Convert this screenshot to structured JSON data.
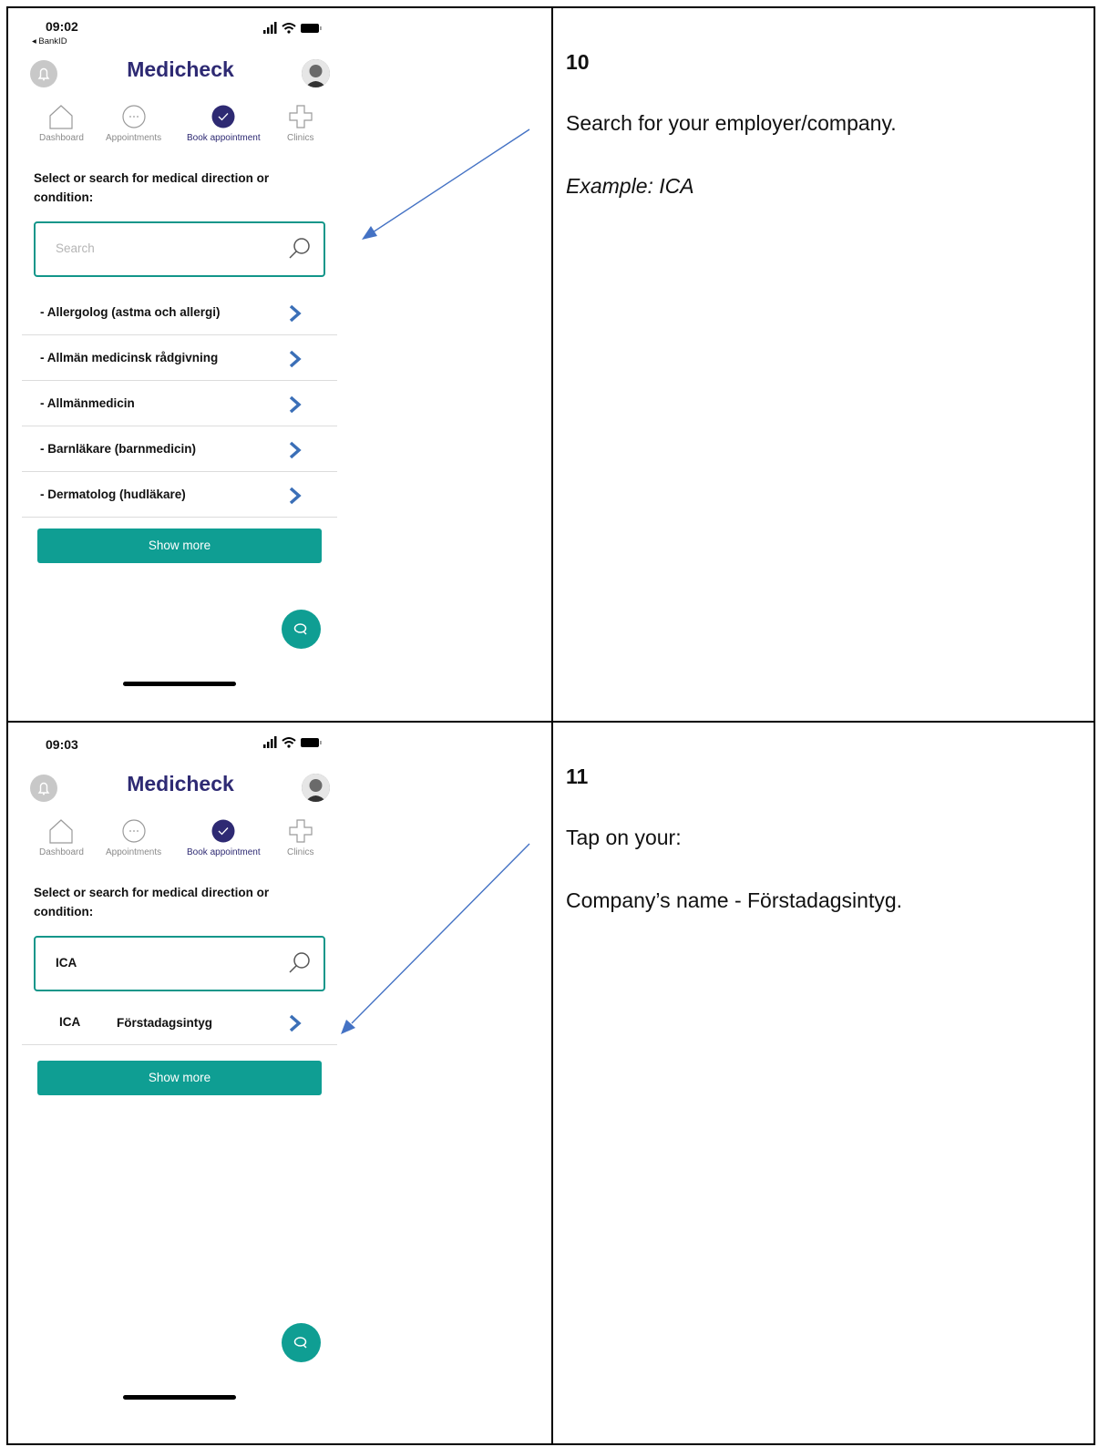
{
  "colors": {
    "brand": "#2e2a73",
    "accent": "#0f9e93",
    "chevron": "#3b6fb7",
    "arrow": "#4472c4"
  },
  "row1": {
    "screen": {
      "time": "09:02",
      "back_label": "◂ BankID",
      "app_title": "Medicheck",
      "nav": [
        "Dashboard",
        "Appointments",
        "Book appointment",
        "Clinics"
      ],
      "heading": "Select or search for medical direction or condition:",
      "search_placeholder": "Search",
      "list": [
        "- Allergolog (astma och allergi)",
        "- Allmän medicinsk rådgivning",
        "- Allmänmedicin",
        "- Barnläkare (barnmedicin)",
        "- Dermatolog (hudläkare)"
      ],
      "show_more": "Show more"
    },
    "step": "10",
    "instructions": [
      "Search for your employer/company.",
      "Example: ICA"
    ]
  },
  "row2": {
    "screen": {
      "time": "09:03",
      "app_title": "Medicheck",
      "nav": [
        "Dashboard",
        "Appointments",
        "Book appointment",
        "Clinics"
      ],
      "heading": "Select or search for medical direction or condition:",
      "search_value": "ICA",
      "result": {
        "code": "ICA",
        "name": "Förstadagsintyg"
      },
      "show_more": "Show more"
    },
    "step": "11",
    "instructions": [
      "Tap on your:",
      "Company’s name - Förstadagsintyg."
    ]
  }
}
